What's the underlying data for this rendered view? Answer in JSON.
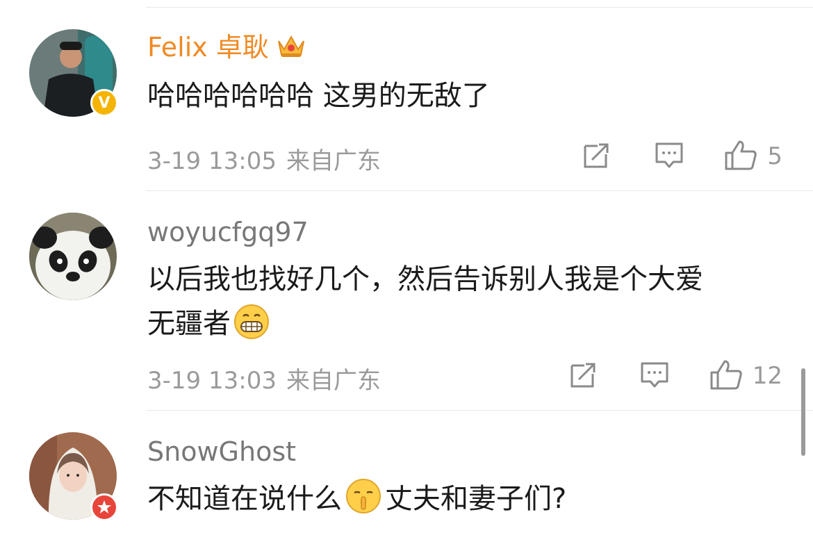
{
  "comments": [
    {
      "username": "Felix 卓耿",
      "text": "哈哈哈哈哈哈 这男的无敌了",
      "time": "3-19 13:05",
      "location": "来自广东",
      "likes": "5",
      "badge": "V"
    },
    {
      "username": "woyucfgq97",
      "text_line1": "以后我也找好几个，然后告诉别人我是个大爱",
      "text_line2": "无疆者",
      "time": "3-19 13:03",
      "location": "来自广东",
      "likes": "12"
    },
    {
      "username": "SnowGhost",
      "text_part1": "不知道在说什么",
      "text_part2": "丈夫和妻子们?"
    }
  ],
  "icons": {
    "crown": "crown-vip-icon",
    "share": "share-icon",
    "comment": "comment-icon",
    "like": "thumbs-up-icon"
  },
  "colors": {
    "vip_name": "#f08a24",
    "gold_badge": "#f5b400",
    "red_badge": "#e8453a",
    "meta": "#9a9a9a"
  }
}
